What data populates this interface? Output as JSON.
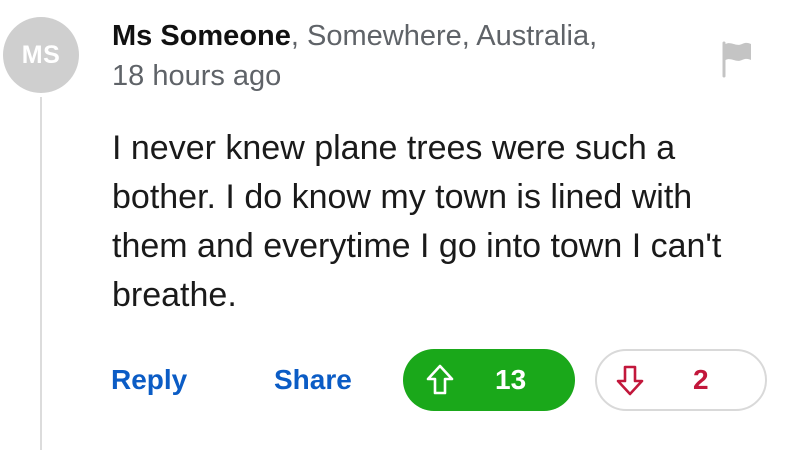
{
  "comment": {
    "avatar_initials": "MS",
    "author": "Ms Someone",
    "location": ", Somewhere, Australia,",
    "timestamp": "18 hours ago",
    "body": "I never knew plane trees were such a bother. I do know my town is lined with them and everytime I go into town I can't breathe.",
    "flag_icon": "flag-icon"
  },
  "actions": {
    "reply_label": "Reply",
    "share_label": "Share",
    "upvote_count": "13",
    "downvote_count": "2",
    "upvote_icon": "arrow-up-icon",
    "downvote_icon": "arrow-down-icon"
  },
  "colors": {
    "link": "#0b5cc5",
    "upvote_bg": "#1aa81a",
    "downvote_fg": "#c2173b",
    "avatar_bg": "#cfcfcf",
    "meta_text": "#5f6368"
  }
}
